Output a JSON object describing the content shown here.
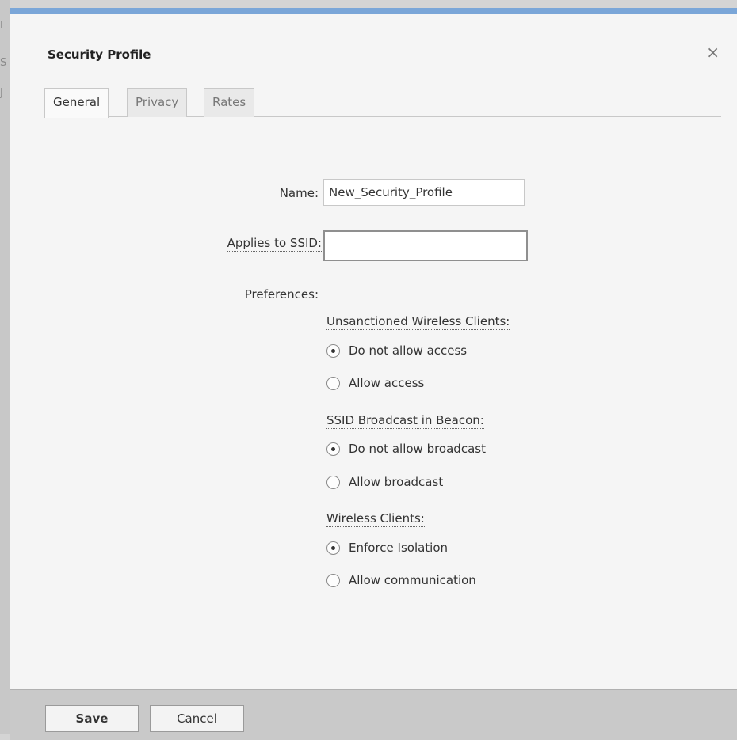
{
  "dialog": {
    "title": "Security Profile",
    "close_glyph": "×"
  },
  "tabs": [
    {
      "label": "General",
      "active": true
    },
    {
      "label": "Privacy",
      "active": false
    },
    {
      "label": "Rates",
      "active": false
    }
  ],
  "form": {
    "name_label": "Name:",
    "name_value": "New_Security_Profile",
    "ssid_label": "Applies to SSID:",
    "ssid_value": "",
    "preferences_label": "Preferences:"
  },
  "groups": [
    {
      "label": "Unsanctioned Wireless Clients:",
      "options": [
        {
          "label": "Do not allow access",
          "checked": true
        },
        {
          "label": "Allow access",
          "checked": false
        }
      ]
    },
    {
      "label": "SSID Broadcast in Beacon:",
      "options": [
        {
          "label": "Do not allow broadcast",
          "checked": true
        },
        {
          "label": "Allow broadcast",
          "checked": false
        }
      ]
    },
    {
      "label": "Wireless Clients:",
      "options": [
        {
          "label": "Enforce Isolation",
          "checked": true
        },
        {
          "label": "Allow communication",
          "checked": false
        }
      ]
    }
  ],
  "footer": {
    "save_label": "Save",
    "cancel_label": "Cancel"
  },
  "colors": {
    "title_bar_accent": "#7aa6d8",
    "dialog_bg": "#f5f5f5",
    "footer_bg": "#c9c9c9"
  },
  "icons": {
    "close": "close-icon",
    "radio": "radio-button"
  }
}
